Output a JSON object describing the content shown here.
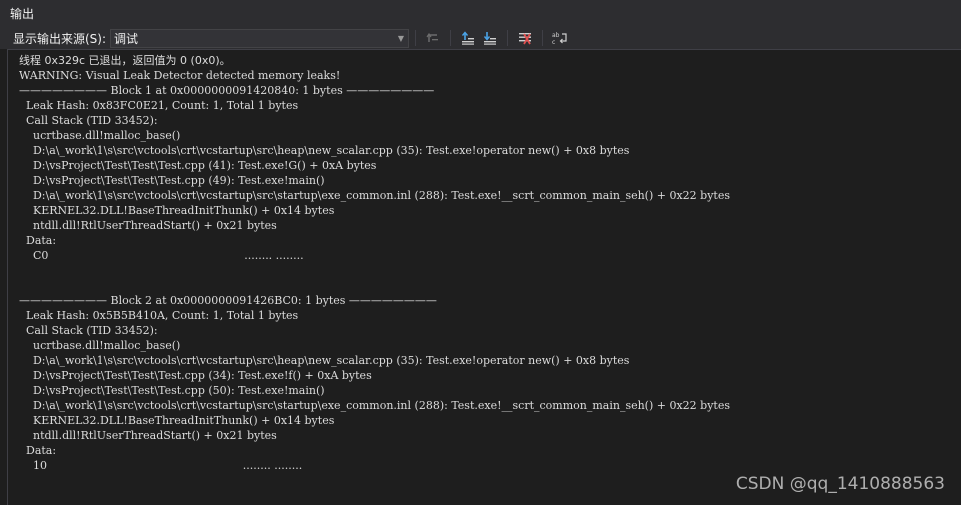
{
  "window": {
    "title": "输出"
  },
  "toolbar": {
    "source_label": "显示输出来源(S):",
    "source_value": "调试",
    "buttons": [
      "goto-prev-message-icon",
      "find-prev-icon",
      "find-next-icon",
      "clear-all-icon",
      "word-wrap-icon"
    ]
  },
  "output": {
    "lines": [
      "线程 0x329c 已退出，返回值为 0 (0x0)。",
      "WARNING: Visual Leak Detector detected memory leaks!",
      "———————— Block 1 at 0x0000000091420840: 1 bytes ————————",
      "  Leak Hash: 0x83FC0E21, Count: 1, Total 1 bytes",
      "  Call Stack (TID 33452):",
      "    ucrtbase.dll!malloc_base()",
      "    D:\\a\\_work\\1\\s\\src\\vctools\\crt\\vcstartup\\src\\heap\\new_scalar.cpp (35): Test.exe!operator new() + 0x8 bytes",
      "    D:\\vsProject\\Test\\Test\\Test.cpp (41): Test.exe!G() + 0xA bytes",
      "    D:\\vsProject\\Test\\Test\\Test.cpp (49): Test.exe!main()",
      "    D:\\a\\_work\\1\\s\\src\\vctools\\crt\\vcstartup\\src\\startup\\exe_common.inl (288): Test.exe!__scrt_common_main_seh() + 0x22 bytes",
      "    KERNEL32.DLL!BaseThreadInitThunk() + 0x14 bytes",
      "    ntdll.dll!RtlUserThreadStart() + 0x21 bytes",
      "  Data:",
      "    C0                                                        ........ ........",
      "",
      "",
      "———————— Block 2 at 0x0000000091426BC0: 1 bytes ————————",
      "  Leak Hash: 0x5B5B410A, Count: 1, Total 1 bytes",
      "  Call Stack (TID 33452):",
      "    ucrtbase.dll!malloc_base()",
      "    D:\\a\\_work\\1\\s\\src\\vctools\\crt\\vcstartup\\src\\heap\\new_scalar.cpp (35): Test.exe!operator new() + 0x8 bytes",
      "    D:\\vsProject\\Test\\Test\\Test.cpp (34): Test.exe!f() + 0xA bytes",
      "    D:\\vsProject\\Test\\Test\\Test.cpp (50): Test.exe!main()",
      "    D:\\a\\_work\\1\\s\\src\\vctools\\crt\\vcstartup\\src\\startup\\exe_common.inl (288): Test.exe!__scrt_common_main_seh() + 0x22 bytes",
      "    KERNEL32.DLL!BaseThreadInitThunk() + 0x14 bytes",
      "    ntdll.dll!RtlUserThreadStart() + 0x21 bytes",
      "  Data:",
      "    10                                                        ........ ........"
    ]
  },
  "watermark": {
    "text": "CSDN @qq_1410888563"
  }
}
